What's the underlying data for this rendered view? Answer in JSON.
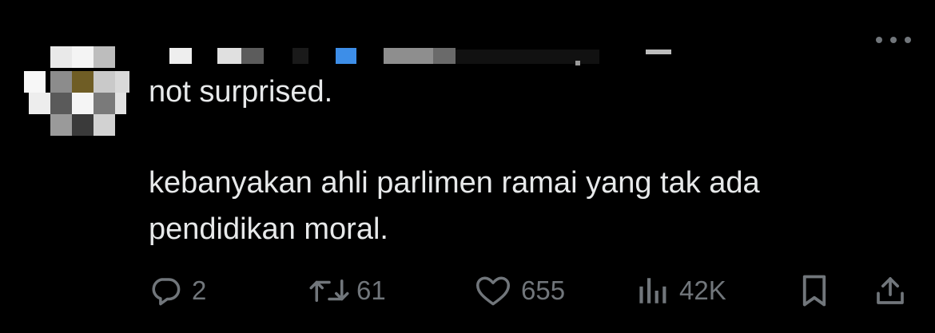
{
  "tweet": {
    "lines": [
      "not surprised.",
      "kebanyakan ahli parlimen ramai yang tak ada",
      "pendidikan moral."
    ],
    "author_censored": true
  },
  "actions": {
    "replies": "2",
    "reposts": "61",
    "likes": "655",
    "views": "42K"
  },
  "icons": {
    "reply": "reply-icon",
    "repost": "repost-icon",
    "like": "heart-icon",
    "views": "analytics-icon",
    "bookmark": "bookmark-icon",
    "share": "share-icon",
    "more": "more-icon"
  },
  "colors": {
    "background": "#000000",
    "text": "#e7e9ea",
    "muted": "#71767b",
    "verified_blue": "#1d9bf0"
  }
}
